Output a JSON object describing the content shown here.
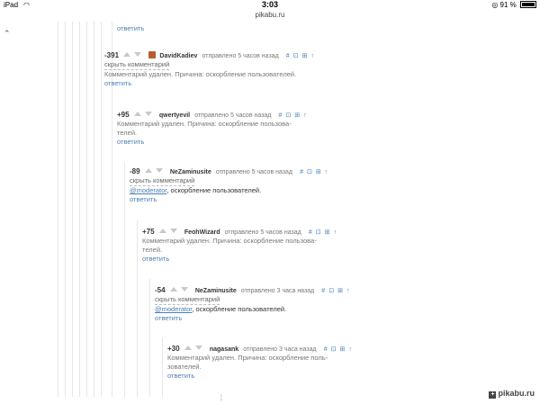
{
  "statusbar": {
    "carrier": "iPad",
    "wifi_icon": "wifi-icon",
    "time": "3:03",
    "battery": "91 %",
    "lock_icon": "orientation-lock-icon"
  },
  "urlbar": {
    "url": "pikabu.ru"
  },
  "top_reply": "ответить",
  "comments": [
    {
      "score": "-391",
      "author": "DavidKadiev",
      "meta": "отправлено 5 часов назад",
      "hide": "скрыть комментарий",
      "text": "Комментарий удален. Причина: оскорбление пользователей.",
      "reply": "ответить"
    },
    {
      "score": "+95",
      "author": "qwertyevil",
      "meta": "отправлено 5 часов назад",
      "text_1": "Комментарий удален. Причина: оскорбление пользова-",
      "text_2": "телей.",
      "reply": "ответить"
    },
    {
      "score": "-89",
      "author": "NeZaminusite",
      "meta": "отправлено 5 часов назад",
      "hide": "скрыть комментарий",
      "mention": "@moderator",
      "text": ", оскорбление пользователей.",
      "reply": "ответить"
    },
    {
      "score": "+75",
      "author": "FeohWizard",
      "meta": "отправлено 5 часов назад",
      "text_1": "Комментарий удален. Причина: оскорбление пользова-",
      "text_2": "телей.",
      "reply": "ответить"
    },
    {
      "score": "-54",
      "author": "NeZaminusite",
      "meta": "отправлено 3 часа назад",
      "hide": "скрыть комментарий",
      "mention": "@moderator",
      "text": ", оскорбление пользователей.",
      "reply": "ответить"
    },
    {
      "score": "+30",
      "author": "nagasank",
      "meta": "отправлено 3 часа назад",
      "text_1": "Комментарий удален. Причина: оскорбление поль-",
      "text_2": "зователей.",
      "reply": "ответить"
    }
  ],
  "tools": {
    "hash": "#",
    "save": "⊡",
    "bookmark": "⊞",
    "up": "↑"
  },
  "bottom_mark": "¦",
  "watermark": "pikabu.ru"
}
